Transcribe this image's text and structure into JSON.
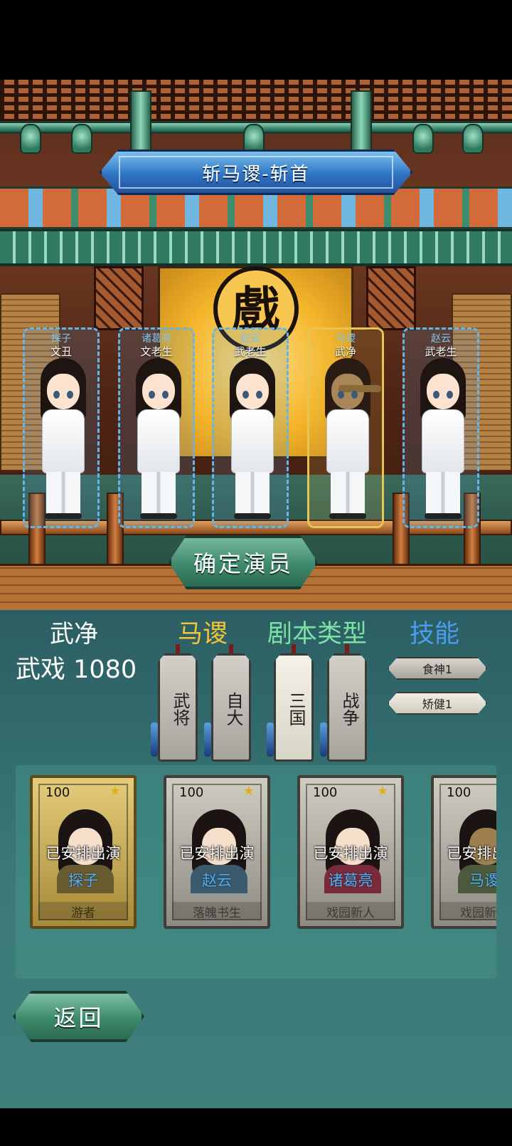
{
  "stage": {
    "play_title": "斩马谡-斩首",
    "stage_glyph": "戲",
    "confirm_label": "确定演员"
  },
  "slots": [
    {
      "name": "探子",
      "role": "文丑",
      "selected": false,
      "complexion": "light"
    },
    {
      "name": "诸葛亮",
      "role": "文老生",
      "selected": false,
      "complexion": "light"
    },
    {
      "name": "赵云",
      "role": "武老生",
      "selected": false,
      "complexion": "light"
    },
    {
      "name": "马谡",
      "role": "武净",
      "selected": true,
      "complexion": "tan"
    },
    {
      "name": "赵云",
      "role": "武老生",
      "selected": false,
      "complexion": "light"
    }
  ],
  "selected_role": {
    "role_type": "武净",
    "score_text": "武戏 1080"
  },
  "headers": {
    "character": "马谡",
    "script_type": "剧本类型",
    "skills": "技能"
  },
  "tags": [
    {
      "text": "武将",
      "active": false
    },
    {
      "text": "自大",
      "active": false
    },
    {
      "text": "三国",
      "active": true
    },
    {
      "text": "战争",
      "active": false
    }
  ],
  "skills": [
    {
      "label": "食神1"
    },
    {
      "label": "矫健1"
    }
  ],
  "actor_cards": [
    {
      "level": "100",
      "status": "已安排出演",
      "actor": "探子",
      "title": "游者",
      "gold": true
    },
    {
      "level": "100",
      "status": "已安排出演",
      "actor": "赵云",
      "title": "落魄书生",
      "gold": false
    },
    {
      "level": "100",
      "status": "已安排出演",
      "actor": "诸葛亮",
      "title": "戏园新人",
      "gold": false
    },
    {
      "level": "100",
      "status": "已安排出演",
      "actor": "马谡",
      "title": "戏园新人",
      "gold": false
    }
  ],
  "back_label": "返回",
  "colors": {
    "slot_border": "#62b6ea",
    "slot_selected": "#e8c552",
    "character_header": "#f3c436",
    "type_header": "#7fe0a6",
    "skill_header": "#4a9df0",
    "actor_name": "#56b0f0"
  }
}
